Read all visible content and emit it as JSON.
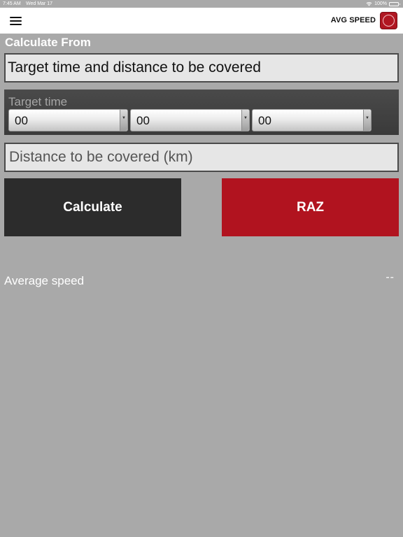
{
  "status_bar": {
    "time": "7:45 AM",
    "date": "Wed Mar 17",
    "battery": "100%",
    "icons": [
      "wifi-icon",
      "battery-icon"
    ]
  },
  "nav": {
    "menu_icon": "hamburger-menu-icon",
    "title": "AVG SPEED",
    "logo_icon": "app-logo-icon"
  },
  "calculate_from": {
    "header": "Calculate From",
    "selected_mode": "Target time and distance to be covered"
  },
  "target_time": {
    "label": "Target time",
    "hours": "00",
    "minutes": "00",
    "seconds": "00"
  },
  "distance": {
    "placeholder": "Distance to be covered (km)",
    "value": ""
  },
  "buttons": {
    "calculate": "Calculate",
    "reset": "RAZ"
  },
  "result": {
    "label": "Average speed",
    "value": "--"
  },
  "colors": {
    "background": "#a9a9a9",
    "calculate_button": "#2c2c2c",
    "reset_button": "#b1131f",
    "panel": "#4a4a4a",
    "logo": "#b01722"
  }
}
